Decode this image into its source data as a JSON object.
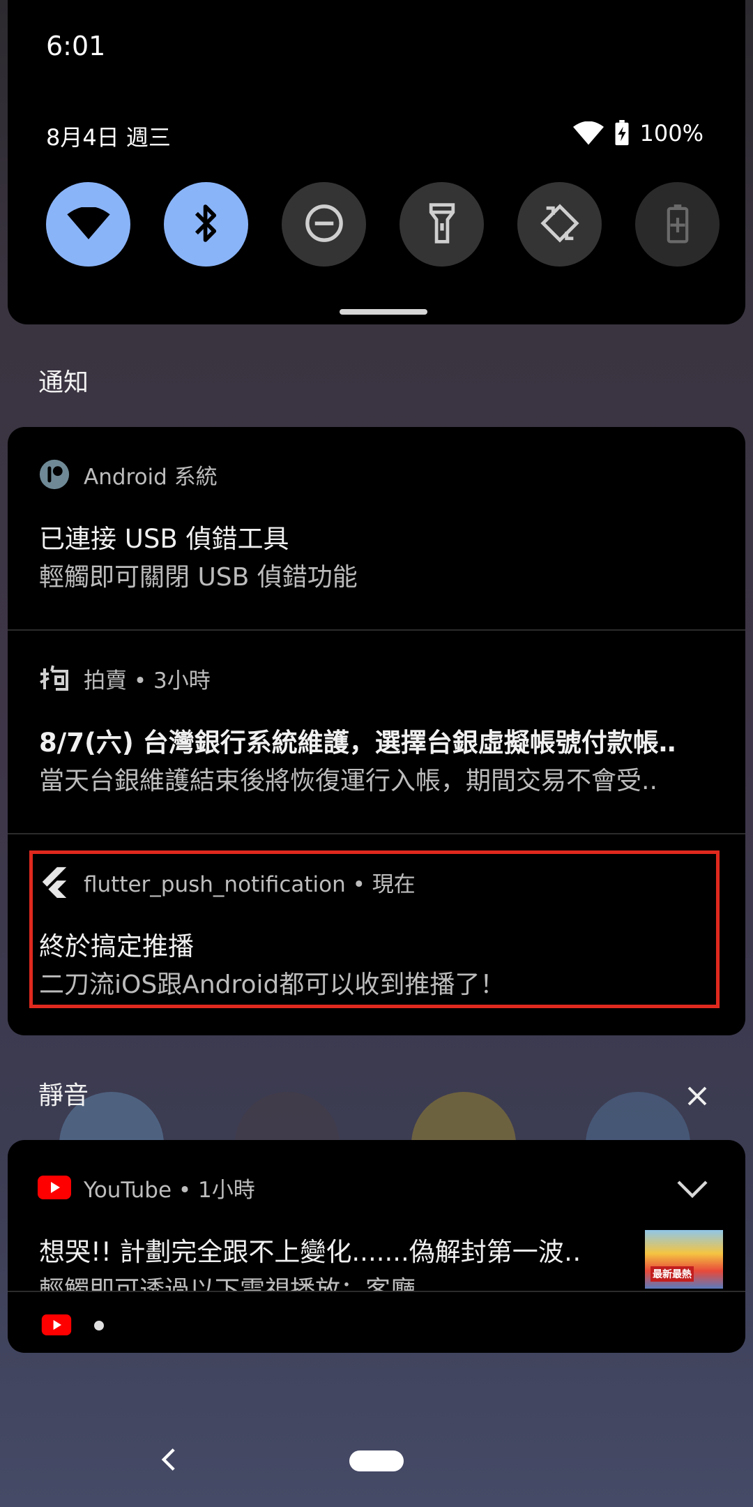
{
  "status_bar": {
    "time": "6:01",
    "date": "8月4日 週三",
    "battery": "100%"
  },
  "quick_settings": {
    "tiles": [
      {
        "name": "wifi-icon",
        "state": "on"
      },
      {
        "name": "bluetooth-icon",
        "state": "on"
      },
      {
        "name": "do-not-disturb-icon",
        "state": "off"
      },
      {
        "name": "flashlight-icon",
        "state": "off"
      },
      {
        "name": "auto-rotate-icon",
        "state": "off"
      },
      {
        "name": "battery-saver-icon",
        "state": "unavailable"
      }
    ],
    "active_color": "#8ab4f8"
  },
  "notifications_header": "通知",
  "notifications": [
    {
      "app": "Android 系統",
      "title": "已連接 USB 偵錯工具",
      "text": "輕觸即可關閉 USB 偵錯功能"
    },
    {
      "app": "拍賣 • 3小時",
      "title": "8/7(六) 台灣銀行系統維護，選擇台銀虛擬帳號付款帳‥",
      "text": "當天台銀維護結束後將恢復運行入帳，期間交易不會受.."
    },
    {
      "app": "flutter_push_notification • 現在",
      "title": "終於搞定推播",
      "text": "二刀流iOS跟Android都可以收到推播了！"
    }
  ],
  "silent_header": "靜音",
  "silent_notifications": [
    {
      "app": "YouTube • 1小時",
      "title": "想哭!! 計劃完全跟不上變化.......偽解封第一波‥",
      "text": "輕觸即可透過以下電視播放：客廳",
      "thumbnail_label": "最新最熱"
    }
  ],
  "colors": {
    "highlight": "#e0291e",
    "youtube_red": "#ff0000"
  }
}
